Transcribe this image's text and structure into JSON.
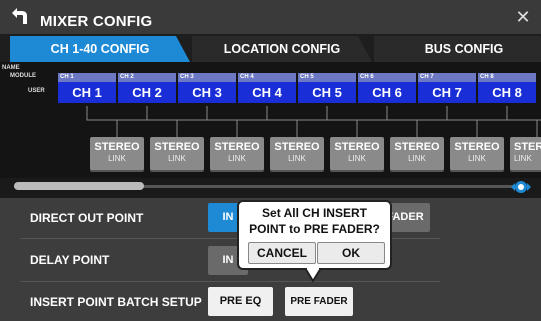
{
  "window": {
    "title": "MIXER CONFIG",
    "close_glyph": "✕"
  },
  "tabs": [
    {
      "label": "CH 1-40 CONFIG",
      "active": true
    },
    {
      "label": "LOCATION CONFIG",
      "active": false
    },
    {
      "label": "BUS CONFIG",
      "active": false
    }
  ],
  "side_labels": {
    "name": "NAME",
    "module": "MODULE",
    "user": "USER"
  },
  "channels": [
    {
      "module": "CH 1",
      "user": "CH 1"
    },
    {
      "module": "CH 2",
      "user": "CH 2"
    },
    {
      "module": "CH 3",
      "user": "CH 3"
    },
    {
      "module": "CH 4",
      "user": "CH 4"
    },
    {
      "module": "CH 5",
      "user": "CH 5"
    },
    {
      "module": "CH 6",
      "user": "CH 6"
    },
    {
      "module": "CH 7",
      "user": "CH 7"
    },
    {
      "module": "CH 8",
      "user": "CH 8"
    }
  ],
  "stereo_link": {
    "line1": "STEREO",
    "line2": "LINK"
  },
  "rows": {
    "direct_out": {
      "label": "DIRECT OUT POINT",
      "btn_left": "IN",
      "btn_right": "FADER"
    },
    "delay": {
      "label": "DELAY POINT",
      "btn_left": "IN"
    },
    "insert_batch": {
      "label": "INSERT POINT BATCH SETUP",
      "btn_pre_eq": "PRE EQ",
      "btn_pre_fader": "PRE FADER"
    }
  },
  "popup": {
    "line1": "Set All CH INSERT",
    "line2": "POINT to PRE FADER?",
    "cancel": "CANCEL",
    "ok": "OK"
  },
  "colors": {
    "accent": "#1e8ad6",
    "channel_user": "#1a2ed8",
    "channel_module": "#6d78c4"
  }
}
